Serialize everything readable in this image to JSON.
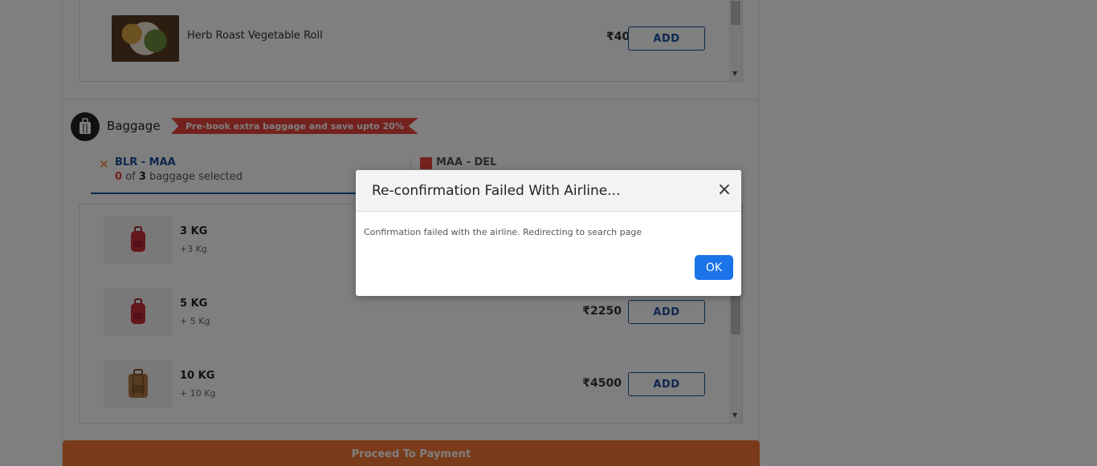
{
  "meal": {
    "name": "Herb Roast Vegetable Roll",
    "price": "₹400",
    "add_label": "ADD"
  },
  "baggage": {
    "title": "Baggage",
    "promo": "Pre-book extra baggage and save upto 20%",
    "tabs": [
      {
        "route": "BLR - MAA",
        "selected_count": "0",
        "of_text": "of",
        "total": "3",
        "suffix": "baggage selected"
      },
      {
        "route": "MAA - DEL"
      }
    ],
    "items": [
      {
        "kg": "3 KG",
        "sub": "+3 Kg",
        "price": "",
        "add_label": "ADD"
      },
      {
        "kg": "5 KG",
        "sub": "+ 5 Kg",
        "price": "₹2250",
        "add_label": "ADD"
      },
      {
        "kg": "10 KG",
        "sub": "+ 10 Kg",
        "price": "₹4500",
        "add_label": "ADD"
      }
    ]
  },
  "footer": {
    "proceed_label": "Proceed To Payment"
  },
  "modal": {
    "title": "Re-confirmation Failed With Airline...",
    "close_glyph": "×",
    "message": "Confirmation failed with the airline. Redirecting to search page",
    "ok_label": "OK"
  },
  "colors": {
    "accent_blue": "#1a4f9c",
    "promo_red": "#e8453c",
    "proceed_orange": "#f47735",
    "ok_blue": "#1a73e8"
  }
}
